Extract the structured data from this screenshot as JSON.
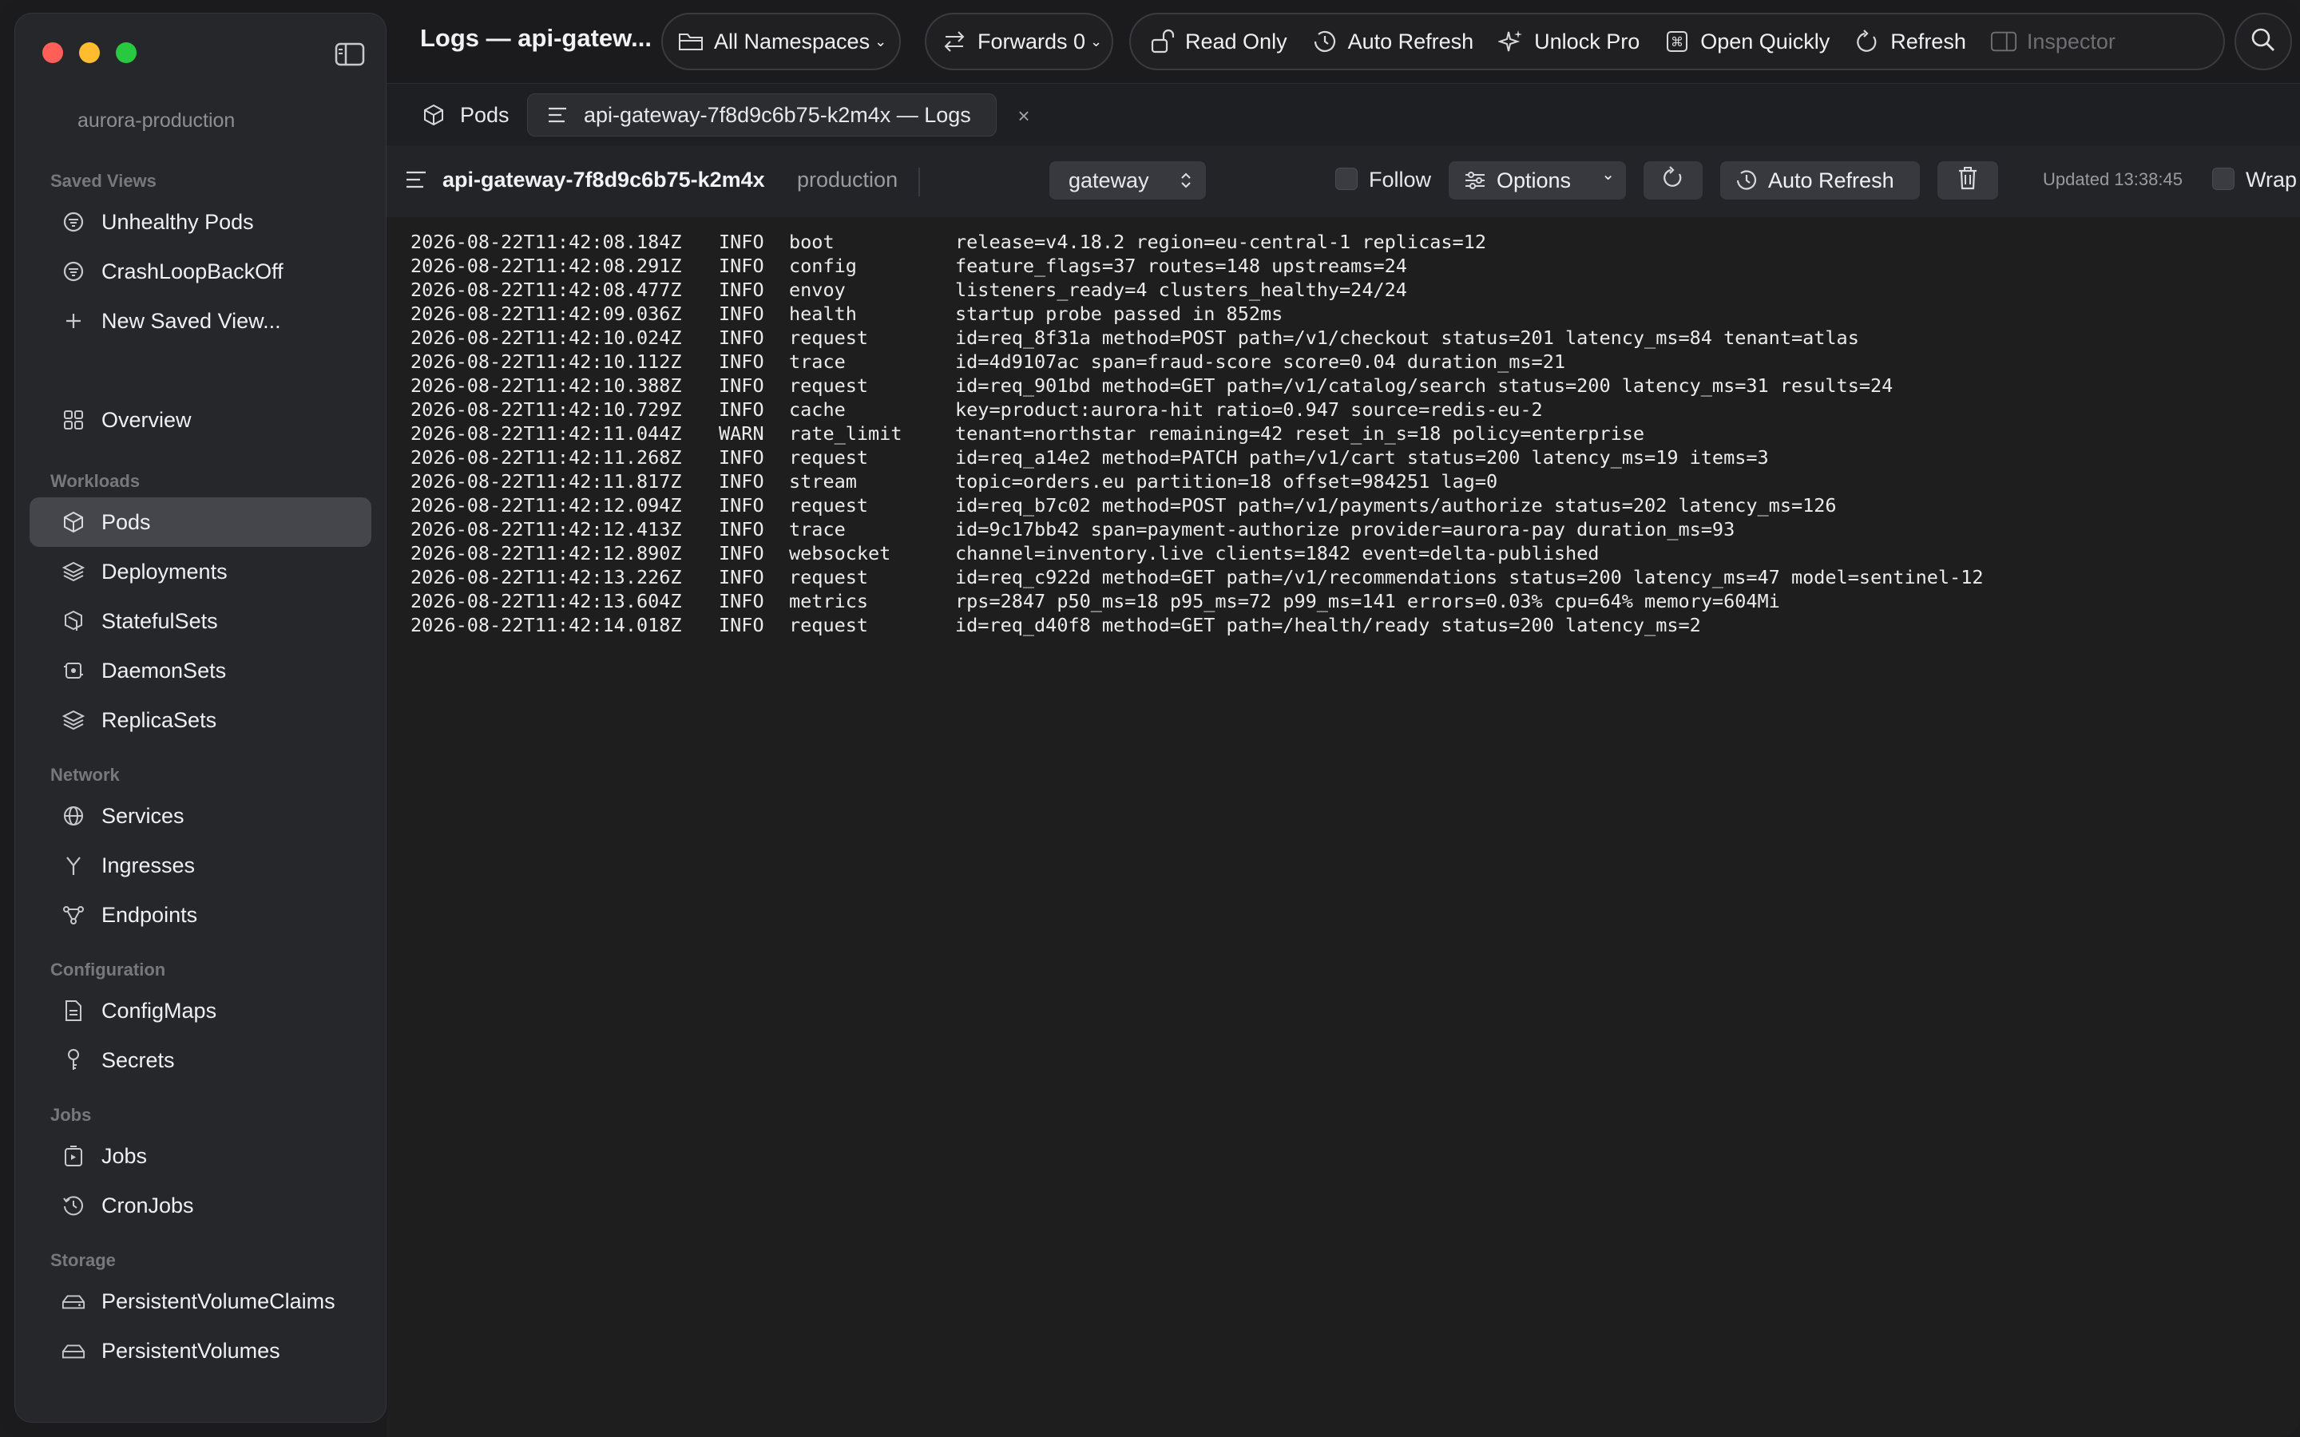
{
  "sidebar": {
    "context": "aurora-production",
    "saved_views_label": "Saved Views",
    "saved_views": [
      "Unhealthy Pods",
      "CrashLoopBackOff",
      "New Saved View..."
    ],
    "overview": "Overview",
    "workloads_label": "Workloads",
    "workloads": [
      "Pods",
      "Deployments",
      "StatefulSets",
      "DaemonSets",
      "ReplicaSets"
    ],
    "network_label": "Network",
    "network": [
      "Services",
      "Ingresses",
      "Endpoints"
    ],
    "configuration_label": "Configuration",
    "configuration": [
      "ConfigMaps",
      "Secrets"
    ],
    "jobs_label": "Jobs",
    "jobs": [
      "Jobs",
      "CronJobs"
    ],
    "storage_label": "Storage",
    "storage": [
      "PersistentVolumeClaims",
      "PersistentVolumes"
    ]
  },
  "toolbar": {
    "title": "Logs — api-gatew...",
    "namespaces": "All Namespaces",
    "forwards": "Forwards 0",
    "read_only": "Read Only",
    "auto_refresh": "Auto Refresh",
    "unlock_pro": "Unlock Pro",
    "open_quickly": "Open Quickly",
    "refresh": "Refresh",
    "inspector": "Inspector"
  },
  "tabs": {
    "pods": "Pods",
    "logs": "api-gateway-7f8d9c6b75-k2m4x — Logs",
    "close": "×"
  },
  "log_header": {
    "pod": "api-gateway-7f8d9c6b75-k2m4x",
    "namespace": "production",
    "container": "gateway",
    "follow": "Follow",
    "options": "Options",
    "auto_refresh": "Auto Refresh",
    "updated": "Updated 13:38:45",
    "wrap": "Wrap"
  },
  "logs": [
    {
      "ts": "2026-08-22T11:42:08.184Z",
      "level": "INFO",
      "comp": "boot",
      "msg": "release=v4.18.2 region=eu-central-1 replicas=12"
    },
    {
      "ts": "2026-08-22T11:42:08.291Z",
      "level": "INFO",
      "comp": "config",
      "msg": "feature_flags=37 routes=148 upstreams=24"
    },
    {
      "ts": "2026-08-22T11:42:08.477Z",
      "level": "INFO",
      "comp": "envoy",
      "msg": "listeners_ready=4 clusters_healthy=24/24"
    },
    {
      "ts": "2026-08-22T11:42:09.036Z",
      "level": "INFO",
      "comp": "health",
      "msg": "startup probe passed in 852ms"
    },
    {
      "ts": "2026-08-22T11:42:10.024Z",
      "level": "INFO",
      "comp": "request",
      "msg": "id=req_8f31a method=POST path=/v1/checkout status=201 latency_ms=84 tenant=atlas"
    },
    {
      "ts": "2026-08-22T11:42:10.112Z",
      "level": "INFO",
      "comp": "trace",
      "msg": "id=4d9107ac span=fraud-score score=0.04 duration_ms=21"
    },
    {
      "ts": "2026-08-22T11:42:10.388Z",
      "level": "INFO",
      "comp": "request",
      "msg": "id=req_901bd method=GET path=/v1/catalog/search status=200 latency_ms=31 results=24"
    },
    {
      "ts": "2026-08-22T11:42:10.729Z",
      "level": "INFO",
      "comp": "cache",
      "msg": "key=product:aurora-hit ratio=0.947 source=redis-eu-2"
    },
    {
      "ts": "2026-08-22T11:42:11.044Z",
      "level": "WARN",
      "comp": "rate_limit",
      "msg": "tenant=northstar remaining=42 reset_in_s=18 policy=enterprise"
    },
    {
      "ts": "2026-08-22T11:42:11.268Z",
      "level": "INFO",
      "comp": "request",
      "msg": "id=req_a14e2 method=PATCH path=/v1/cart status=200 latency_ms=19 items=3"
    },
    {
      "ts": "2026-08-22T11:42:11.817Z",
      "level": "INFO",
      "comp": "stream",
      "msg": "topic=orders.eu partition=18 offset=984251 lag=0"
    },
    {
      "ts": "2026-08-22T11:42:12.094Z",
      "level": "INFO",
      "comp": "request",
      "msg": "id=req_b7c02 method=POST path=/v1/payments/authorize status=202 latency_ms=126"
    },
    {
      "ts": "2026-08-22T11:42:12.413Z",
      "level": "INFO",
      "comp": "trace",
      "msg": "id=9c17bb42 span=payment-authorize provider=aurora-pay duration_ms=93"
    },
    {
      "ts": "2026-08-22T11:42:12.890Z",
      "level": "INFO",
      "comp": "websocket",
      "msg": "channel=inventory.live clients=1842 event=delta-published"
    },
    {
      "ts": "2026-08-22T11:42:13.226Z",
      "level": "INFO",
      "comp": "request",
      "msg": "id=req_c922d method=GET path=/v1/recommendations status=200 latency_ms=47 model=sentinel-12"
    },
    {
      "ts": "2026-08-22T11:42:13.604Z",
      "level": "INFO",
      "comp": "metrics",
      "msg": "rps=2847 p50_ms=18 p95_ms=72 p99_ms=141 errors=0.03% cpu=64% memory=604Mi"
    },
    {
      "ts": "2026-08-22T11:42:14.018Z",
      "level": "INFO",
      "comp": "request",
      "msg": "id=req_d40f8 method=GET path=/health/ready status=200 latency_ms=2"
    }
  ]
}
